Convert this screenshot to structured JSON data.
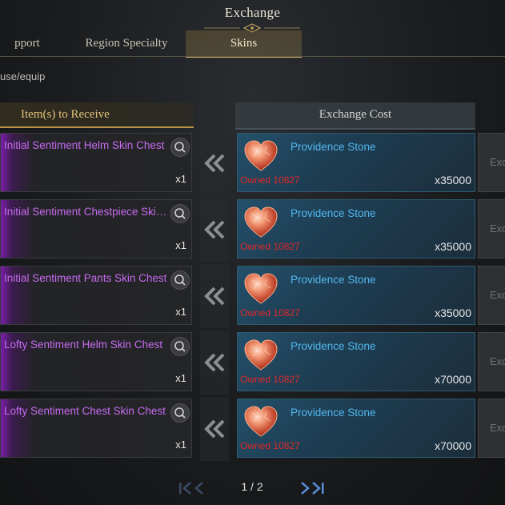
{
  "window": {
    "title": "Exchange"
  },
  "tabs": [
    {
      "label": "pport"
    },
    {
      "label": "Region Specialty"
    },
    {
      "label": "Skins",
      "active": true
    }
  ],
  "hint": "use/equip",
  "headers": {
    "receive": "Item(s) to Receive",
    "cost": "Exchange Cost"
  },
  "rows": [
    {
      "item": "Initial Sentiment Helm Skin Chest",
      "item_qty": "x1",
      "cost_item": "Providence Stone",
      "owned": "Owned 10827",
      "cost_qty": "x35000",
      "button": "Exc"
    },
    {
      "item": "Initial Sentiment Chestpiece Skin...",
      "item_qty": "x1",
      "cost_item": "Providence Stone",
      "owned": "Owned 10827",
      "cost_qty": "x35000",
      "button": "Exc"
    },
    {
      "item": "Initial Sentiment Pants Skin Chest",
      "item_qty": "x1",
      "cost_item": "Providence Stone",
      "owned": "Owned 10827",
      "cost_qty": "x35000",
      "button": "Exc"
    },
    {
      "item": "Lofty Sentiment Helm Skin Chest",
      "item_qty": "x1",
      "cost_item": "Providence Stone",
      "owned": "Owned 10827",
      "cost_qty": "x70000",
      "button": "Exc"
    },
    {
      "item": "Lofty Sentiment Chest Skin Chest",
      "item_qty": "x1",
      "cost_item": "Providence Stone",
      "owned": "Owned 10827",
      "cost_qty": "x70000",
      "button": "Exc"
    }
  ],
  "pagination": {
    "text": "1 / 2"
  },
  "colors": {
    "item_name": "#c76bf0",
    "cost_name": "#52b8f0",
    "owned": "#e02828",
    "active_tab_underline": "#d9b96a"
  },
  "icons": {
    "receive_arrow": "double-chevron-left-icon",
    "search": "magnify-icon",
    "cost": "heart-stone-icon"
  }
}
